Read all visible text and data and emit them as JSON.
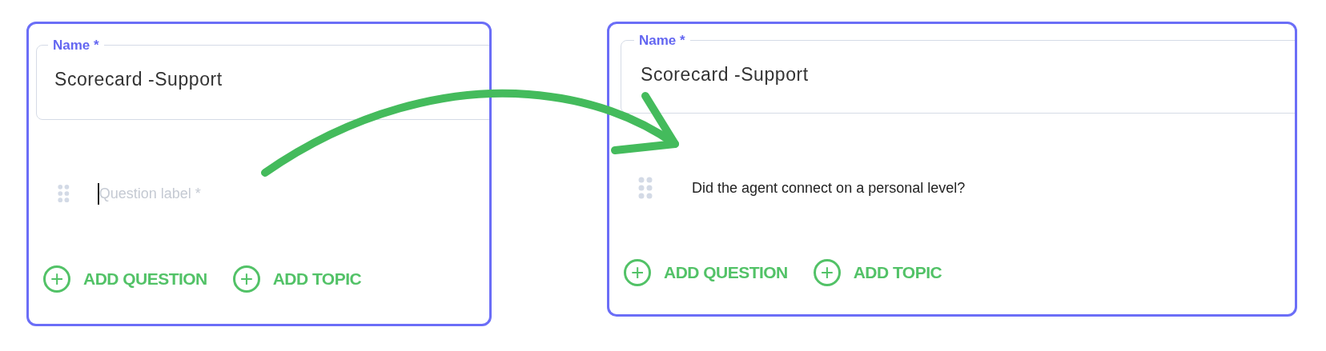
{
  "panels": [
    {
      "name_field": {
        "label": "Name *",
        "value": "Scorecard -Support"
      },
      "question": {
        "placeholder": "Question label *",
        "focused": true
      },
      "buttons": [
        {
          "icon": "+",
          "label": "ADD QUESTION"
        },
        {
          "icon": "+",
          "label": "ADD TOPIC"
        }
      ]
    },
    {
      "name_field": {
        "label": "Name *",
        "value": "Scorecard -Support"
      },
      "question": {
        "value": "Did the agent connect on a personal level?",
        "focused": false
      },
      "buttons": [
        {
          "icon": "+",
          "label": "ADD QUESTION"
        },
        {
          "icon": "+",
          "label": "ADD TOPIC"
        }
      ]
    }
  ]
}
